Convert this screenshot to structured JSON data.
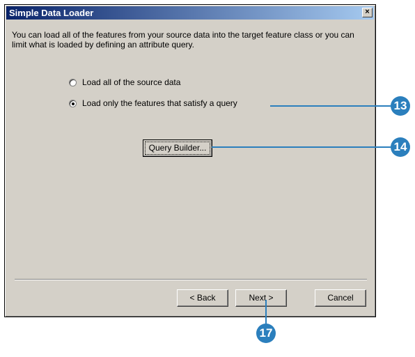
{
  "window": {
    "title": "Simple Data Loader",
    "close_glyph": "×"
  },
  "description": "You can load all of the features from your source data into the target feature class or you can limit what is loaded by defining an attribute query.",
  "options": [
    {
      "label": "Load all of the source data",
      "checked": false
    },
    {
      "label": "Load only the features that satisfy a query",
      "checked": true
    }
  ],
  "query_builder_label": "Query Builder...",
  "footer": {
    "back_label": "< Back",
    "next_label": "Next >",
    "cancel_label": "Cancel"
  },
  "callouts": {
    "c13": "13",
    "c14": "14",
    "c17": "17"
  },
  "colors": {
    "callout": "#2b7fbd",
    "title_start": "#0a246a",
    "dialog_bg": "#d4d0c8"
  }
}
